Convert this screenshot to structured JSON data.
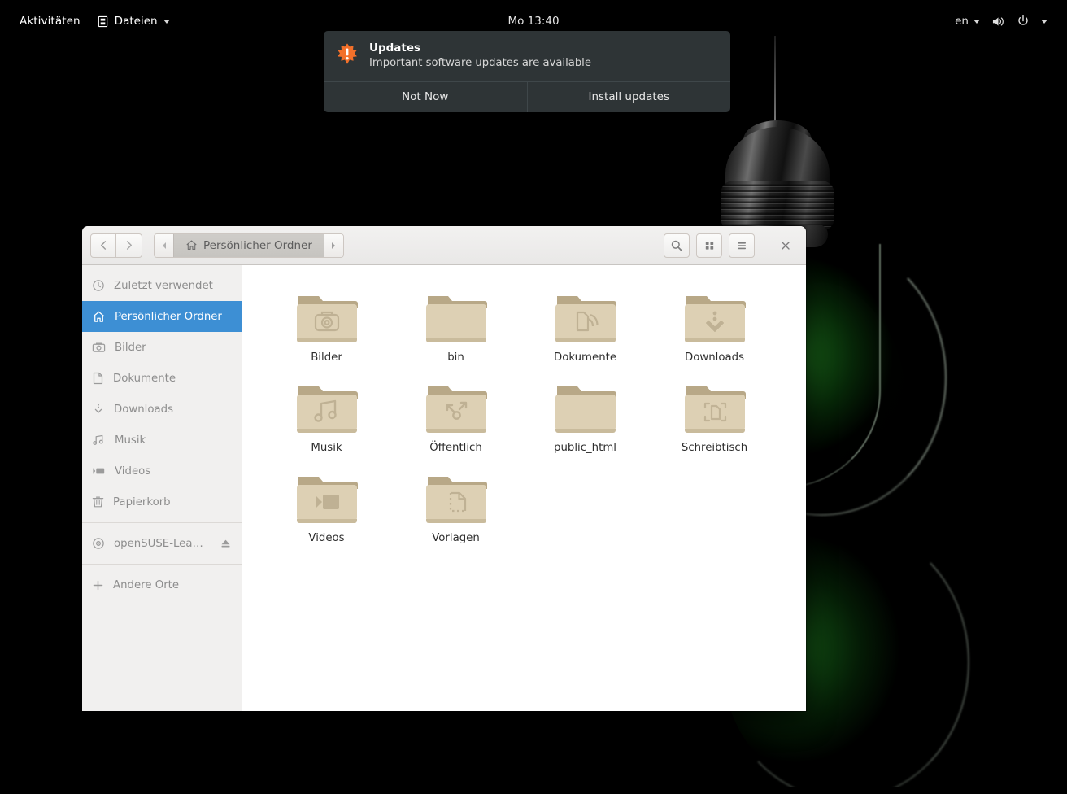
{
  "topbar": {
    "activities": "Aktivitäten",
    "app_menu": "Dateien",
    "app_icon": "files-icon",
    "clock": "Mo 13:40",
    "keyboard_layout": "en",
    "volume_icon": "volume-icon",
    "power_icon": "power-icon"
  },
  "notification": {
    "icon": "update-warning-icon",
    "title": "Updates",
    "subtitle": "Important software updates are available",
    "buttons": [
      {
        "label": "Not Now",
        "name": "not-now-button"
      },
      {
        "label": "Install updates",
        "name": "install-updates-button"
      }
    ],
    "background": "#2e3436",
    "accent": "#f3702a"
  },
  "window": {
    "title": "Persönlicher Ordner",
    "breadcrumb_icon": "home-icon",
    "nav": {
      "back": "back-icon",
      "forward": "forward-icon"
    },
    "path_prev": "path-left-arrow",
    "path_next": "path-right-arrow",
    "header_buttons": [
      {
        "name": "search-button",
        "icon": "search-icon"
      },
      {
        "name": "view-grid-button",
        "icon": "grid-icon"
      },
      {
        "name": "menu-button",
        "icon": "hamburger-icon"
      }
    ],
    "close_label": "×",
    "selection_color": "#3d8fd4"
  },
  "sidebar": {
    "items": [
      {
        "label": "Zuletzt verwendet",
        "icon": "clock-icon",
        "selected": false
      },
      {
        "label": "Persönlicher Ordner",
        "icon": "home-icon",
        "selected": true
      },
      {
        "label": "Bilder",
        "icon": "camera-icon",
        "selected": false
      },
      {
        "label": "Dokumente",
        "icon": "document-icon",
        "selected": false
      },
      {
        "label": "Downloads",
        "icon": "download-icon",
        "selected": false
      },
      {
        "label": "Musik",
        "icon": "music-icon",
        "selected": false
      },
      {
        "label": "Videos",
        "icon": "video-icon",
        "selected": false
      },
      {
        "label": "Papierkorb",
        "icon": "trash-icon",
        "selected": false
      }
    ],
    "devices": [
      {
        "label": "openSUSE-Lea…",
        "icon": "disc-icon",
        "eject": "eject-icon"
      }
    ],
    "other": {
      "label": "Andere Orte",
      "icon": "plus-icon"
    }
  },
  "files": [
    {
      "name": "Bilder",
      "emblem": "camera-emblem"
    },
    {
      "name": "bin",
      "emblem": "none"
    },
    {
      "name": "Dokumente",
      "emblem": "documents-emblem"
    },
    {
      "name": "Downloads",
      "emblem": "download-emblem"
    },
    {
      "name": "Musik",
      "emblem": "music-emblem"
    },
    {
      "name": "Öffentlich",
      "emblem": "share-emblem"
    },
    {
      "name": "public_html",
      "emblem": "none"
    },
    {
      "name": "Schreibtisch",
      "emblem": "desktop-emblem"
    },
    {
      "name": "Videos",
      "emblem": "video-emblem"
    },
    {
      "name": "Vorlagen",
      "emblem": "templates-emblem"
    }
  ],
  "wallpaper": {
    "description": "light-bulb-green-glow",
    "background": "#000000",
    "glow": "#1a7a1c"
  }
}
